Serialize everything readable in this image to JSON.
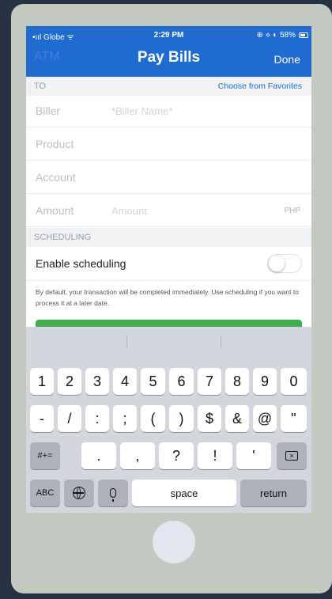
{
  "status_bar": {
    "carrier": "•ııl Globe ᯤ",
    "time": "2:29 PM",
    "right": "⊕ ⟡ ◐ 58%"
  },
  "nav": {
    "left": "ATM",
    "title": "Pay Bills",
    "done": "Done"
  },
  "to_section": {
    "header": "TO",
    "favorites_link": "Choose from Favorites"
  },
  "fields": {
    "biller_label": "Biller",
    "biller_placeholder": "*Biller Name*",
    "product_label": "Product",
    "account_label": "Account",
    "amount_label": "Amount",
    "amount_placeholder": "Amount",
    "amount_unit": "PHP"
  },
  "scheduling": {
    "header": "SCHEDULING",
    "toggle_label": "Enable scheduling",
    "toggle_on": false,
    "note": "By default, your transaction will be completed immediately. Use scheduling if you want to process it at a later date."
  },
  "keyboard": {
    "row1": [
      "1",
      "2",
      "3",
      "4",
      "5",
      "6",
      "7",
      "8",
      "9",
      "0"
    ],
    "row2": [
      "-",
      "/",
      ":",
      ";",
      "(",
      ")",
      "$",
      "&",
      "@",
      "\""
    ],
    "row3": [
      "#+=",
      ".",
      ",",
      "?",
      "!",
      "'"
    ],
    "row4": {
      "abc": "ABC",
      "space": "space",
      "return": "return"
    }
  },
  "colors": {
    "header_blue": "#1f6bd0",
    "accent_green": "#3fb04c",
    "device_body": "#c3c9c1",
    "background": "#263142"
  }
}
